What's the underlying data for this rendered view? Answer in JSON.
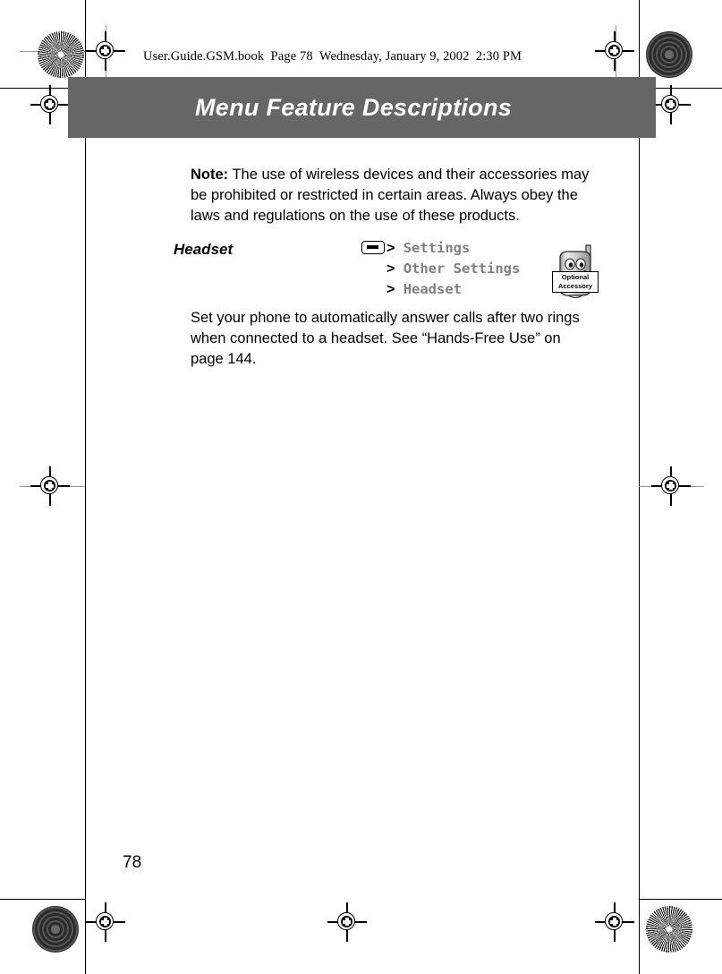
{
  "slug": {
    "text": "User.Guide.GSM.book  Page 78  Wednesday, January 9, 2002  2:30 PM"
  },
  "running_head": {
    "chapter_title": "Menu Feature Descriptions",
    "band_color": "#666666",
    "text_color": "#ffffff"
  },
  "note": {
    "label": "Note:",
    "text": " The use of wireless devices and their accessories may be prohibited or restricted in certain areas. Always obey the laws and regulations on the use of these products."
  },
  "feature": {
    "heading": "Headset",
    "description": "Set your phone to automatically answer calls after two rings when connected to a headset. See “Hands-Free Use” on page 144.",
    "menu_path": {
      "key_icon": "menu-key-icon",
      "separator": ">",
      "steps": [
        "Settings",
        "Other Settings",
        "Headset"
      ],
      "text_color": "#808080"
    },
    "accessory_badge": {
      "line1": "Optional",
      "line2": "Accessory",
      "icon": "phone-mascot-icon"
    }
  },
  "folio": {
    "page_number": "78"
  },
  "print_marks": {
    "registration_icon": "registration-target-icon",
    "starburst_icon": "starburst-density-target-icon",
    "halftone_icon": "halftone-density-target-icon"
  }
}
